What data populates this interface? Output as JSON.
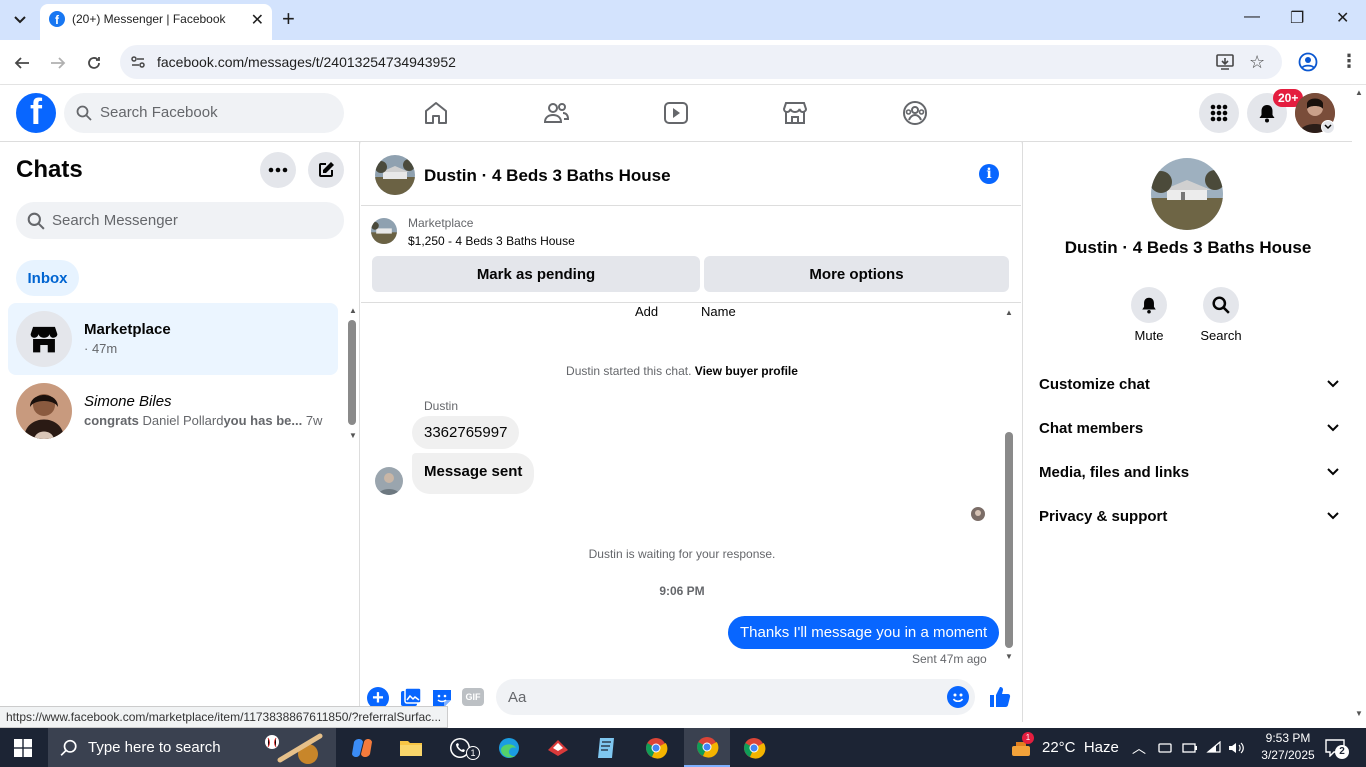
{
  "browser": {
    "tab_title": "(20+) Messenger | Facebook",
    "url": "facebook.com/messages/t/24013254734943952"
  },
  "fb_header": {
    "search_placeholder": "Search Facebook",
    "notification_badge": "20+"
  },
  "chats": {
    "title": "Chats",
    "search_placeholder": "Search Messenger",
    "filter_inbox": "Inbox",
    "items": [
      {
        "name": "Marketplace",
        "preview": "· 47m"
      },
      {
        "name": "Simone Biles",
        "preview_bold": "congrats",
        "preview_name": " Daniel Pollard",
        "preview_rest": "you has be...",
        "time": " 7w"
      }
    ]
  },
  "conversation": {
    "title": "Dustin · 4 Beds 3 Baths House",
    "marketplace_label": "Marketplace",
    "listing": "$1,250 - 4 Beds 3 Baths House",
    "mark_pending": "Mark as pending",
    "more_options": "More options",
    "top_labels": [
      "Add",
      "Name"
    ],
    "started_text": "Dustin started this chat.",
    "view_profile": "View buyer profile",
    "sender": "Dustin",
    "messages_in": [
      "3362765997",
      "Message sent"
    ],
    "waiting_text": "Dustin is waiting for your response.",
    "timestamp": "9:06 PM",
    "message_out": "Thanks I'll message you in a moment",
    "sent_status": "Sent 47m ago",
    "composer_placeholder": "Aa",
    "gif_label": "GIF"
  },
  "info_panel": {
    "name": "Dustin · 4 Beds 3 Baths House",
    "mute": "Mute",
    "search": "Search",
    "sections": [
      "Customize chat",
      "Chat members",
      "Media, files and links",
      "Privacy & support"
    ]
  },
  "status_link": "https://www.facebook.com/marketplace/item/1173838867611850/?referralSurfac...",
  "taskbar": {
    "search_placeholder": "Type here to search",
    "weather": "22°C  Haze",
    "time": "9:53 PM",
    "date": "3/27/2025",
    "notif_count": "2",
    "whatsapp_badge": "1",
    "weather_badge": "1"
  },
  "colors": {
    "fb_blue": "#0866ff",
    "accent_light": "#e7f3ff",
    "badge_red": "#e41e3f"
  }
}
